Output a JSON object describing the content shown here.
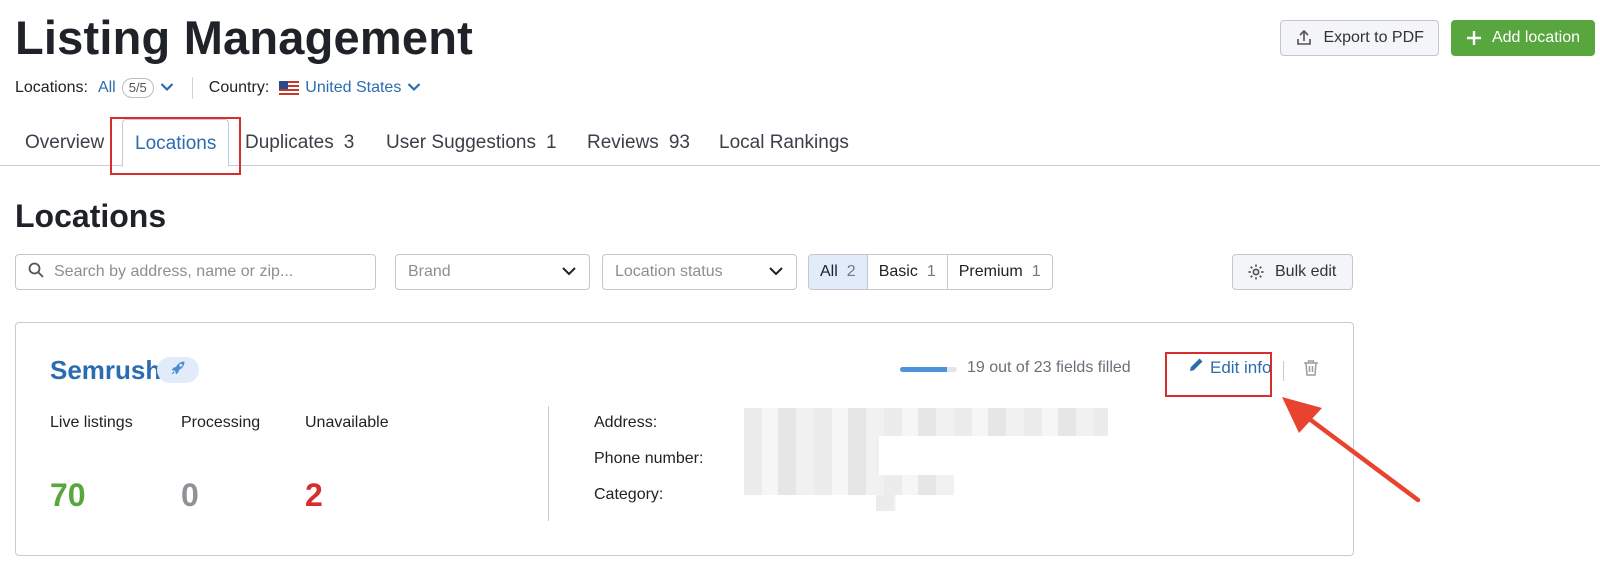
{
  "header": {
    "title": "Listing Management",
    "export_label": "Export to PDF",
    "add_label": "Add location"
  },
  "filters": {
    "locations_label": "Locations:",
    "locations_value": "All",
    "locations_count": "5/5",
    "country_label": "Country:",
    "country_value": "United States"
  },
  "tabs": [
    {
      "label": "Overview",
      "count": ""
    },
    {
      "label": "Locations",
      "count": "",
      "active": true
    },
    {
      "label": "Duplicates",
      "count": "3"
    },
    {
      "label": "User Suggestions",
      "count": "1"
    },
    {
      "label": "Reviews",
      "count": "93"
    },
    {
      "label": "Local Rankings",
      "count": ""
    }
  ],
  "section": {
    "title": "Locations",
    "search_placeholder": "Search by address, name or zip...",
    "brand_placeholder": "Brand",
    "status_placeholder": "Location status",
    "segments": [
      {
        "label": "All",
        "count": "2",
        "active": true
      },
      {
        "label": "Basic",
        "count": "1"
      },
      {
        "label": "Premium",
        "count": "1"
      }
    ],
    "bulk_edit_label": "Bulk edit"
  },
  "location_card": {
    "name": "Semrush",
    "fields_text": "19 out of 23 fields filled",
    "fields_progress": 0.83,
    "edit_label": "Edit info",
    "stats": [
      {
        "label": "Live listings",
        "value": "70",
        "color": "#58a63e"
      },
      {
        "label": "Processing",
        "value": "0",
        "color": "#8f9196"
      },
      {
        "label": "Unavailable",
        "value": "2",
        "color": "#d62d2d"
      }
    ],
    "info_labels": {
      "address": "Address:",
      "phone": "Phone number:",
      "category": "Category:"
    }
  },
  "colors": {
    "accent_blue": "#2b6cb0",
    "primary_green": "#58a63e",
    "highlight_red": "#d62d2d"
  }
}
